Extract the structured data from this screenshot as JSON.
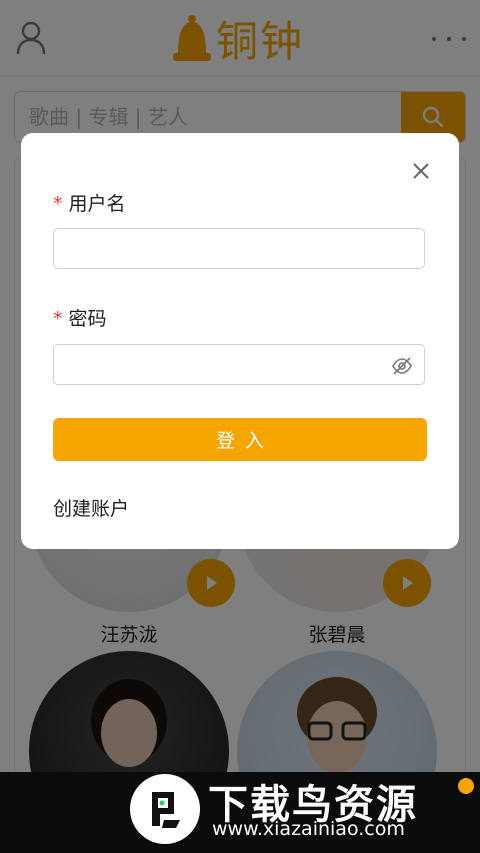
{
  "app": {
    "brand": "铜钟",
    "accent_color": "#F5A400"
  },
  "search": {
    "placeholder": "歌曲 | 专辑 | 艺人",
    "button_icon": "search-icon"
  },
  "artists": [
    {
      "name": "汪苏泷"
    },
    {
      "name": "张碧晨"
    },
    {
      "name": ""
    },
    {
      "name": ""
    }
  ],
  "login_dialog": {
    "username_label": "用户名",
    "password_label": "密码",
    "required_mark": "*",
    "login_button": "登入",
    "create_account": "创建账户",
    "close_icon": "close-icon",
    "visibility_icon": "eye-off-icon"
  },
  "watermark": {
    "title": "下载鸟资源",
    "url": "www.xiazainiao.com"
  }
}
